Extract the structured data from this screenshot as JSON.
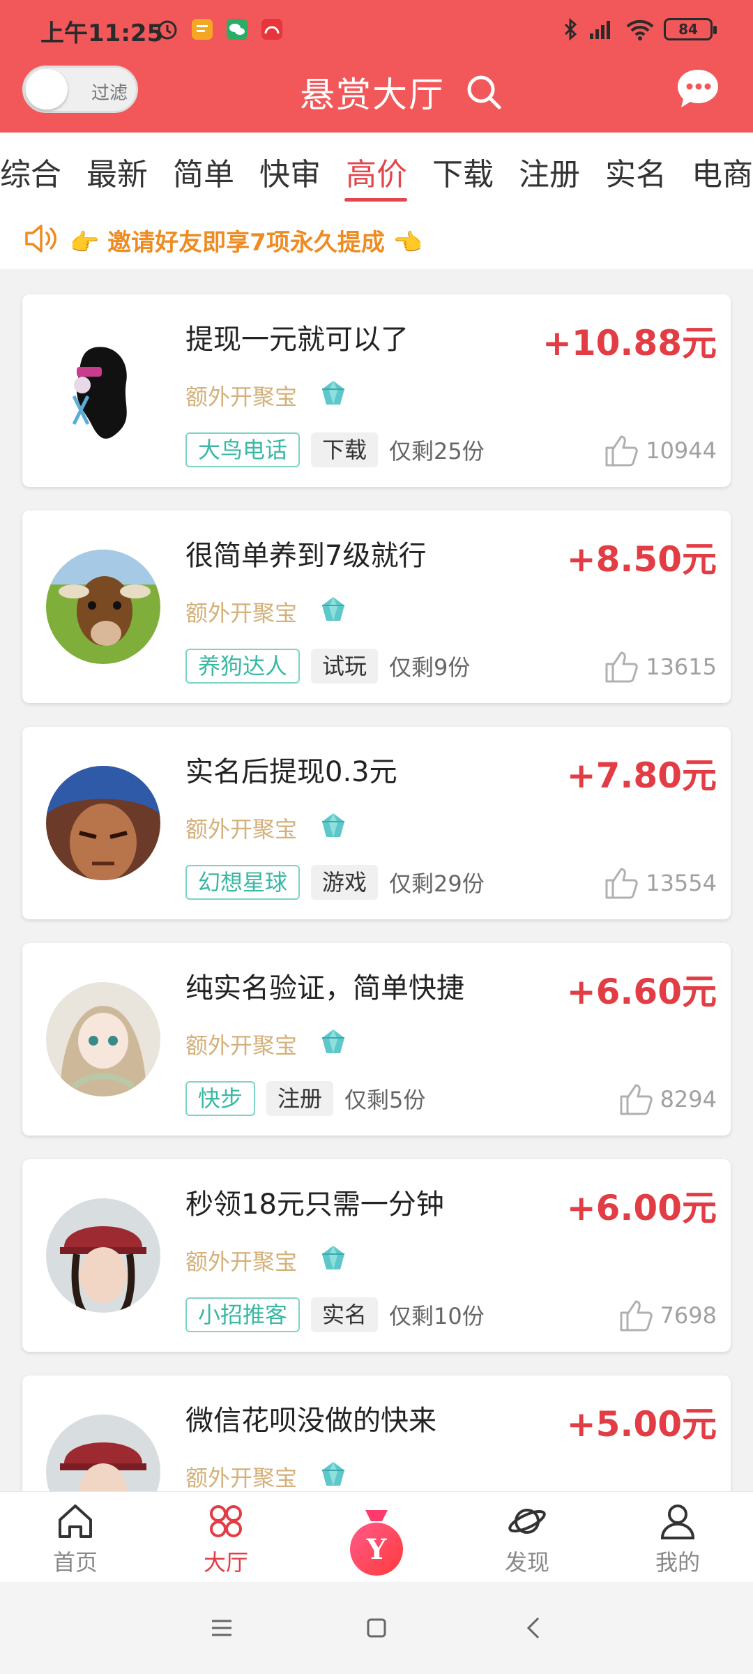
{
  "status_bar": {
    "time": "上午11:25",
    "battery": "84"
  },
  "header": {
    "filter_label": "过滤",
    "title": "悬赏大厅"
  },
  "tabs": [
    {
      "label": "综合"
    },
    {
      "label": "最新"
    },
    {
      "label": "简单"
    },
    {
      "label": "快审"
    },
    {
      "label": "高价"
    },
    {
      "label": "下载"
    },
    {
      "label": "注册"
    },
    {
      "label": "实名"
    },
    {
      "label": "电商"
    }
  ],
  "active_tab": "高价",
  "notice": {
    "text": "👉 邀请好友即享7项永久提成 👈"
  },
  "tasks": [
    {
      "title": "提现一元就可以了",
      "reward": "+10.88元",
      "subtitle": "额外开聚宝",
      "tag": "大鸟电话",
      "category": "下载",
      "remaining": "仅剩25份",
      "likes": "10944"
    },
    {
      "title": "很简单养到7级就行",
      "reward": "+8.50元",
      "subtitle": "额外开聚宝",
      "tag": "养狗达人",
      "category": "试玩",
      "remaining": "仅剩9份",
      "likes": "13615"
    },
    {
      "title": "实名后提现0.3元",
      "reward": "+7.80元",
      "subtitle": "额外开聚宝",
      "tag": "幻想星球",
      "category": "游戏",
      "remaining": "仅剩29份",
      "likes": "13554"
    },
    {
      "title": "纯实名验证，简单快捷",
      "reward": "+6.60元",
      "subtitle": "额外开聚宝",
      "tag": "快步",
      "category": "注册",
      "remaining": "仅剩5份",
      "likes": "8294"
    },
    {
      "title": "秒领18元只需一分钟",
      "reward": "+6.00元",
      "subtitle": "额外开聚宝",
      "tag": "小招推客",
      "category": "实名",
      "remaining": "仅剩10份",
      "likes": "7698"
    },
    {
      "title": "微信花呗没做的快来",
      "reward": "+5.00元",
      "subtitle": "额外开聚宝"
    }
  ],
  "bottom_nav": [
    {
      "label": "首页"
    },
    {
      "label": "大厅"
    },
    {
      "label": "发现"
    },
    {
      "label": "我的"
    }
  ],
  "center_button_glyph": "Y",
  "colors": {
    "header_bg": "#f2575a",
    "accent_red": "#e23c45",
    "tag_teal": "#39b8a3",
    "notice_orange": "#ee8b22",
    "sub_gold": "#d4b07a"
  }
}
